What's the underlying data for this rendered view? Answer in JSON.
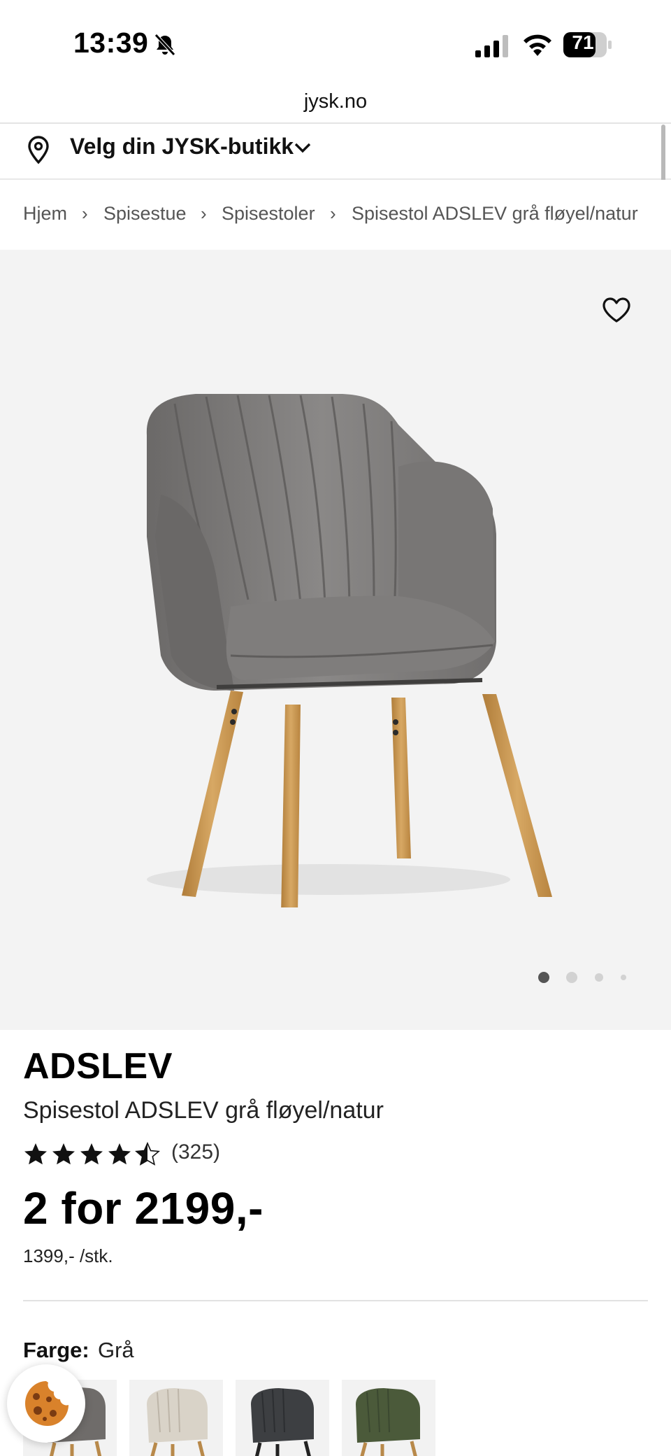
{
  "status_bar": {
    "time": "13:39",
    "battery": "71",
    "icons": [
      "bell-muted-icon",
      "signal-icon",
      "wifi-icon",
      "battery-icon"
    ]
  },
  "browser": {
    "url": "jysk.no"
  },
  "store": {
    "label": "Velg din JYSK-butikk",
    "icon": "location-pin-icon"
  },
  "breadcrumb": [
    {
      "label": "Hjem"
    },
    {
      "label": "Spisestue"
    },
    {
      "label": "Spisestoler"
    },
    {
      "label": "Spisestol ADSLEV grå fløyel/natur"
    }
  ],
  "gallery": {
    "image_count": 4,
    "active_index": 0,
    "favorite_icon": "heart-outline-icon"
  },
  "product": {
    "brand": "ADSLEV",
    "name": "Spisestol ADSLEV grå fløyel/natur",
    "rating": 4.5,
    "rating_max": 5,
    "review_count": "(325)",
    "price": "2 for 2199,-",
    "unit_price": "1399,- /stk."
  },
  "color_picker": {
    "label": "Farge:",
    "value": "Grå",
    "swatches": [
      {
        "name": "Grå",
        "color": "#6f6c6a",
        "legs": "#b8894a"
      },
      {
        "name": "Beige",
        "color": "#d9d3c8",
        "legs": "#b8894a"
      },
      {
        "name": "Mørkegrå",
        "color": "#3d3f42",
        "legs": "#222222"
      },
      {
        "name": "Grønn",
        "color": "#4b5a3a",
        "legs": "#b8894a"
      }
    ]
  },
  "cookie": {
    "icon": "cookie-icon"
  },
  "colors": {
    "accent": "#111111",
    "gallery_bg": "#f3f3f3",
    "chair_fabric": "#7a7877",
    "chair_legs": "#c89a55"
  }
}
